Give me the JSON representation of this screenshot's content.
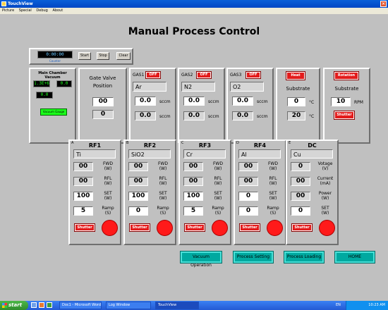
{
  "window": {
    "title": "TouchView"
  },
  "menu": [
    "Picture",
    "Special",
    "Debug",
    "About"
  ],
  "page_title": "Manual Process Control",
  "timer": {
    "display": "0:00:00",
    "caption": "Counter",
    "start": "Start",
    "stop": "Stop",
    "clear": "Clear"
  },
  "vacuum": {
    "title": "Main Chamber Vacuum",
    "reading1": "1.3E+6",
    "reading2": "0.0",
    "reading3": "0.0",
    "gauge_button": "Vacuum Gauge"
  },
  "gate_valve": {
    "title_line1": "Gate Valve",
    "title_line2": "Position",
    "value1": "00",
    "value2": "0"
  },
  "gases": [
    {
      "label": "GAS1",
      "state": "OFF",
      "name": "Ar",
      "setpoint": "0.0",
      "actual": "0.0",
      "unit": "sccm"
    },
    {
      "label": "GAS2",
      "state": "OFF",
      "name": "N2",
      "setpoint": "0.0",
      "actual": "0.0",
      "unit": "sccm"
    },
    {
      "label": "GAS3",
      "state": "OFF",
      "name": "O2",
      "setpoint": "0.0",
      "actual": "0.0",
      "unit": "sccm"
    }
  ],
  "heat": {
    "button": "Heat",
    "label": "Substrate",
    "setpoint": "0",
    "actual": "20",
    "unit": "°C"
  },
  "rotation": {
    "button": "Rotation",
    "label": "Substrate",
    "value": "10",
    "unit": "RPM",
    "shutter": "Shutter"
  },
  "sources": [
    {
      "letter": "A",
      "title": "RF1",
      "material": "Ti",
      "r1": "00",
      "r2": "00",
      "r3": "100",
      "r4": "5",
      "l1a": "FWD",
      "l1b": "(W)",
      "l2a": "RFL",
      "l2b": "(W)",
      "l3a": "SET",
      "l3b": "(W)",
      "l4a": "Ramp",
      "l4b": "(S)",
      "shutter": "Shutter"
    },
    {
      "letter": "B",
      "title": "RF2",
      "material": "SiO2",
      "r1": "00",
      "r2": "00",
      "r3": "100",
      "r4": "0",
      "l1a": "FWD",
      "l1b": "(W)",
      "l2a": "RFL",
      "l2b": "(W)",
      "l3a": "SET",
      "l3b": "(W)",
      "l4a": "Ramp",
      "l4b": "(S)",
      "shutter": "Shutter"
    },
    {
      "letter": "C",
      "title": "RF3",
      "material": "Cr",
      "r1": "00",
      "r2": "00",
      "r3": "100",
      "r4": "5",
      "l1a": "FWD",
      "l1b": "(W)",
      "l2a": "RFL",
      "l2b": "(W)",
      "l3a": "SET",
      "l3b": "(W)",
      "l4a": "Ramp",
      "l4b": "(S)",
      "shutter": "Shutter"
    },
    {
      "letter": "D",
      "title": "RF4",
      "material": "Al",
      "r1": "00",
      "r2": "00",
      "r3": "0",
      "r4": "0",
      "l1a": "FWD",
      "l1b": "(W)",
      "l2a": "RFL",
      "l2b": "(W)",
      "l3a": "SET",
      "l3b": "(W)",
      "l4a": "Ramp",
      "l4b": "(S)",
      "shutter": "Shutter"
    },
    {
      "letter": "E",
      "title": "DC",
      "material": "Cu",
      "r1": "0",
      "r2": "00",
      "r3": "00",
      "r4": "0",
      "l1a": "Votage",
      "l1b": "(V)",
      "l2a": "Current",
      "l2b": "(mA)",
      "l3a": "Power",
      "l3b": "(W)",
      "l4a": "SET",
      "l4b": "(W)",
      "shutter": "Shutter"
    }
  ],
  "nav": [
    "Vacuum Operation",
    "Process Setting",
    "Process Loading",
    "HOME"
  ],
  "taskbar": {
    "start": "start",
    "tasks": [
      "Doc1 - Microsoft Word",
      "Log Window",
      "TouchView"
    ],
    "lang": "EN",
    "clock": "10:23 AM"
  },
  "colors": {
    "accent_red": "#e31b1b",
    "nav_teal": "#00a9a0",
    "lcd_green": "#1aff1a"
  }
}
